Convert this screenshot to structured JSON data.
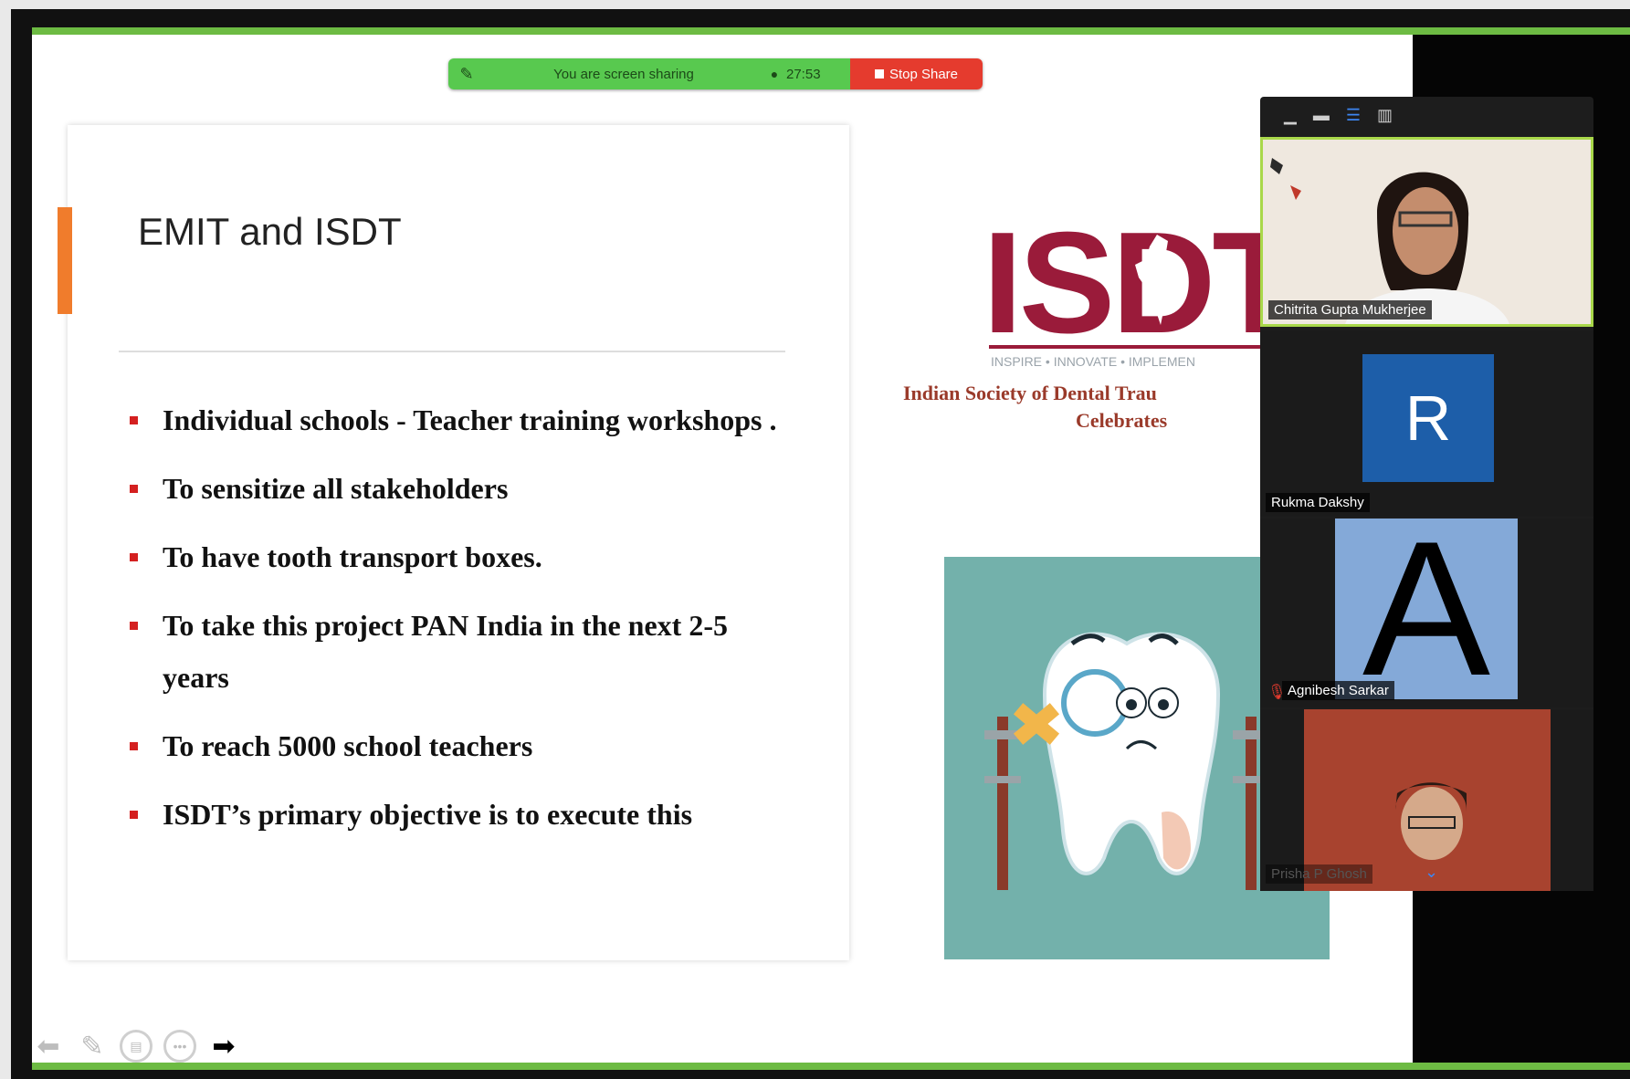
{
  "share_bar": {
    "status_label": "You are screen sharing",
    "elapsed_time": "27:53",
    "stop_label": "Stop Share",
    "colors": {
      "bar": "#58c94f",
      "stop": "#e53b2e"
    }
  },
  "slide": {
    "title": "EMIT and ISDT",
    "bullets": [
      "Individual schools - Teacher training workshops .",
      "To sensitize all stakeholders",
      "To have tooth transport boxes.",
      "To take this project PAN India in the next 2-5 years",
      "To reach 5000 school teachers",
      "ISDT’s primary objective is to execute this"
    ],
    "accent_color": "#f07c2c",
    "bullet_color": "#d42020"
  },
  "logo": {
    "letters": "ISDT",
    "tagline": "INSPIRE • INNOVATE • IMPLEMEN",
    "full_name": "Indian Society of Dental Trau",
    "celebrates": "Celebrates",
    "color": "#9a1b3a"
  },
  "participants": [
    {
      "name": "Chitrita Gupta Mukherjee",
      "type": "video"
    },
    {
      "name": "Rukma Dakshy",
      "type": "avatar",
      "initial": "R",
      "color": "#1d5ea9"
    },
    {
      "name": "Agnibesh Sarkar",
      "type": "avatar",
      "initial": "A",
      "color": "#84a9d8",
      "muted": true
    },
    {
      "name": "Prisha P Ghosh",
      "type": "video"
    }
  ],
  "view_toolbar": [
    "minimize-icon",
    "speaker-view-icon",
    "gallery-strip-icon",
    "gallery-grid-icon"
  ],
  "slide_controls": [
    "previous-slide-icon",
    "pen-icon",
    "slides-overview-icon",
    "more-options-icon",
    "next-slide-icon"
  ]
}
